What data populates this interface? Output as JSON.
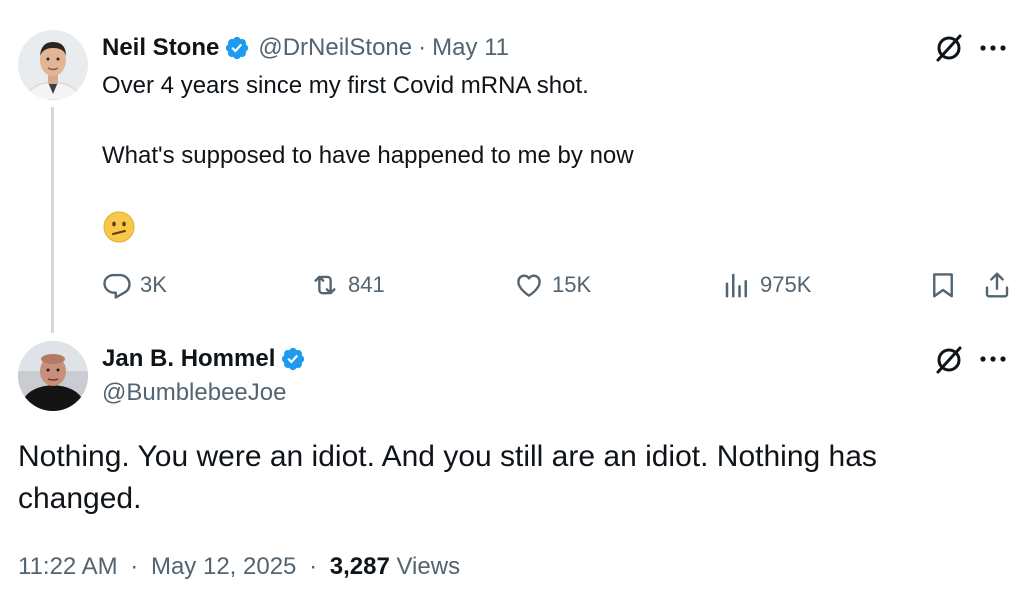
{
  "tweet": {
    "author_name": "Neil Stone",
    "handle": "@DrNeilStone",
    "separator": "·",
    "date": "May 11",
    "text_line1": "Over 4 years since my first Covid mRNA shot.",
    "text_line2": "What's supposed to have happened to me by now",
    "emoji": "confused-face",
    "stats": {
      "replies": "3K",
      "retweets": "841",
      "likes": "15K",
      "views": "975K"
    }
  },
  "reply": {
    "author_name": "Jan B. Hommel",
    "handle": "@BumblebeeJoe",
    "text": "Nothing. You were an idiot. And you still are an idiot. Nothing has changed.",
    "time": "11:22 AM",
    "separator": "·",
    "date": "May 12, 2025",
    "view_count": "3,287",
    "views_label": "Views"
  },
  "icons": {
    "verified": "verified-badge-icon",
    "grok": "grok-icon",
    "more": "more-icon",
    "reply": "reply-icon",
    "retweet": "retweet-icon",
    "like": "heart-icon",
    "views": "views-chart-icon",
    "bookmark": "bookmark-icon",
    "share": "share-icon"
  },
  "colors": {
    "text": "#0f1419",
    "secondary": "#536471",
    "verified_blue": "#1d9bf0",
    "thread_line": "#cfd9de"
  }
}
